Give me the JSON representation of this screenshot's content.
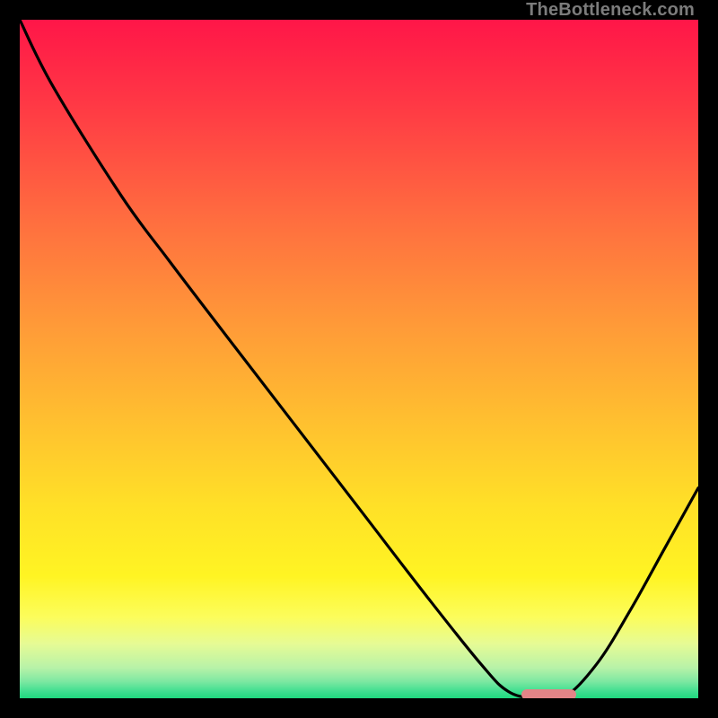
{
  "watermark": "TheBottleneck.com",
  "colors": {
    "frame": "#000000",
    "curve": "#000000",
    "marker": "#e38487",
    "watermark": "#7c7c7c",
    "gradient_stops": [
      {
        "offset": 0.0,
        "color": "#ff1648"
      },
      {
        "offset": 0.12,
        "color": "#ff3745"
      },
      {
        "offset": 0.3,
        "color": "#ff6f3f"
      },
      {
        "offset": 0.45,
        "color": "#ff9a38"
      },
      {
        "offset": 0.6,
        "color": "#ffc22f"
      },
      {
        "offset": 0.72,
        "color": "#ffe127"
      },
      {
        "offset": 0.82,
        "color": "#fff423"
      },
      {
        "offset": 0.88,
        "color": "#fcfd5b"
      },
      {
        "offset": 0.92,
        "color": "#e6fb95"
      },
      {
        "offset": 0.955,
        "color": "#b8f2a8"
      },
      {
        "offset": 0.975,
        "color": "#7ee8a2"
      },
      {
        "offset": 0.99,
        "color": "#3fdf90"
      },
      {
        "offset": 1.0,
        "color": "#1fd97f"
      }
    ]
  },
  "chart_data": {
    "type": "line",
    "title": "",
    "xlabel": "",
    "ylabel": "",
    "x_range": [
      0,
      100
    ],
    "y_range": [
      0,
      100
    ],
    "x": [
      0,
      5,
      15,
      22,
      30,
      40,
      50,
      60,
      68,
      72,
      76,
      80,
      85,
      90,
      95,
      100
    ],
    "values": [
      100,
      90,
      74,
      64.5,
      54,
      41,
      28,
      15,
      5,
      1,
      0,
      0,
      5,
      13,
      22,
      31
    ],
    "notes": "Single V-shaped curve reaching minimum (≈0) around x≈76–80; slope change (kink) near x≈22. Values are percentages estimated from the gradient-backed plot.",
    "marker": {
      "x_start": 74,
      "x_end": 82,
      "y": 0
    }
  }
}
